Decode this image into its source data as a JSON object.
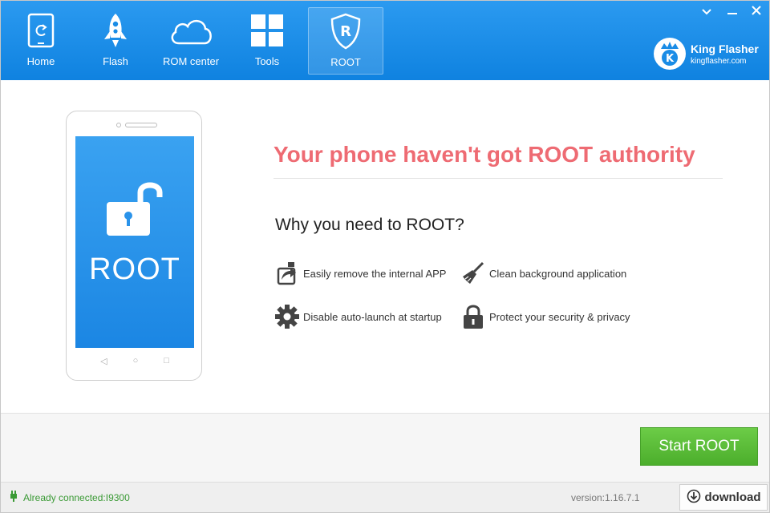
{
  "nav": {
    "home": "Home",
    "flash": "Flash",
    "rom_center": "ROM center",
    "tools": "Tools",
    "root": "ROOT"
  },
  "brand": {
    "name": "King Flasher",
    "site": "kingflasher.com"
  },
  "phone": {
    "screen_label": "ROOT"
  },
  "main": {
    "headline": "Your phone haven't got ROOT authority",
    "why_heading": "Why you need to ROOT?",
    "features": [
      {
        "label": "Easily remove the internal APP",
        "icon": "uninstall-icon"
      },
      {
        "label": "Clean background application",
        "icon": "broom-icon"
      },
      {
        "label": "Disable auto-launch at startup",
        "icon": "gear-icon"
      },
      {
        "label": "Protect your security & privacy",
        "icon": "lock-icon"
      }
    ]
  },
  "actions": {
    "start_root": "Start ROOT"
  },
  "status": {
    "connection": "Already connected:I9300",
    "version": "version:1.16.7.1",
    "download": "download"
  },
  "colors": {
    "topbar": "#1a8ce6",
    "headline": "#ee6b73",
    "start_button": "#5bbd39",
    "connected_text": "#3a9a35"
  }
}
